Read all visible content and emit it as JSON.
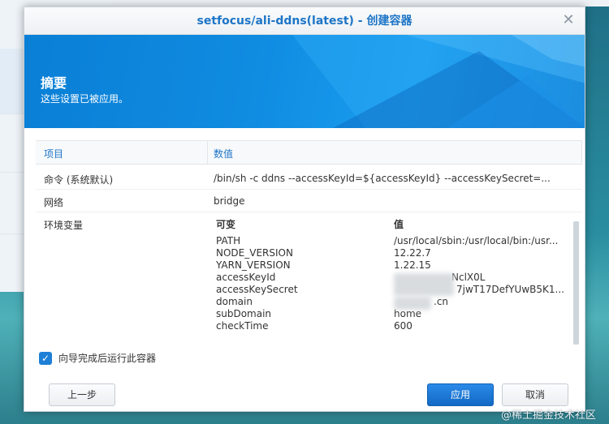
{
  "window": {
    "title": "setfocus/ali-ddns(latest) - 创建容器",
    "close_label": "✕"
  },
  "banner": {
    "title": "摘要",
    "subtitle": "这些设置已被应用。"
  },
  "table": {
    "headers": [
      "项目",
      "数值"
    ],
    "rows": [
      {
        "key": "命令 (系统默认)",
        "value": "/bin/sh -c ddns --accessKeyId=${accessKeyId} --accessKeySecret=..."
      },
      {
        "key": "网络",
        "value": "bridge"
      },
      {
        "key": "环境变量",
        "value": ""
      }
    ],
    "env": {
      "headers": [
        "可变",
        "值"
      ],
      "items": [
        {
          "name": "PATH",
          "value": "/usr/local/sbin:/usr/local/bin:/usr..."
        },
        {
          "name": "NODE_VERSION",
          "value": "12.22.7"
        },
        {
          "name": "YARN_VERSION",
          "value": "1.22.15"
        },
        {
          "name": "accessKeyId",
          "value": "NclX0L"
        },
        {
          "name": "accessKeySecret",
          "value": "7jwT17DefYUwB5K1..."
        },
        {
          "name": "domain",
          "value": ".cn"
        },
        {
          "name": "subDomain",
          "value": "home"
        },
        {
          "name": "checkTime",
          "value": "600"
        }
      ]
    }
  },
  "checkbox": {
    "label": "向导完成后运行此容器",
    "checked": true
  },
  "buttons": {
    "prev": "上一步",
    "apply": "应用",
    "cancel": "取消"
  },
  "watermark": "@稀土掘金技术社区",
  "colors": {
    "accent": "#1d75c7",
    "banner": "#0f8be0"
  }
}
